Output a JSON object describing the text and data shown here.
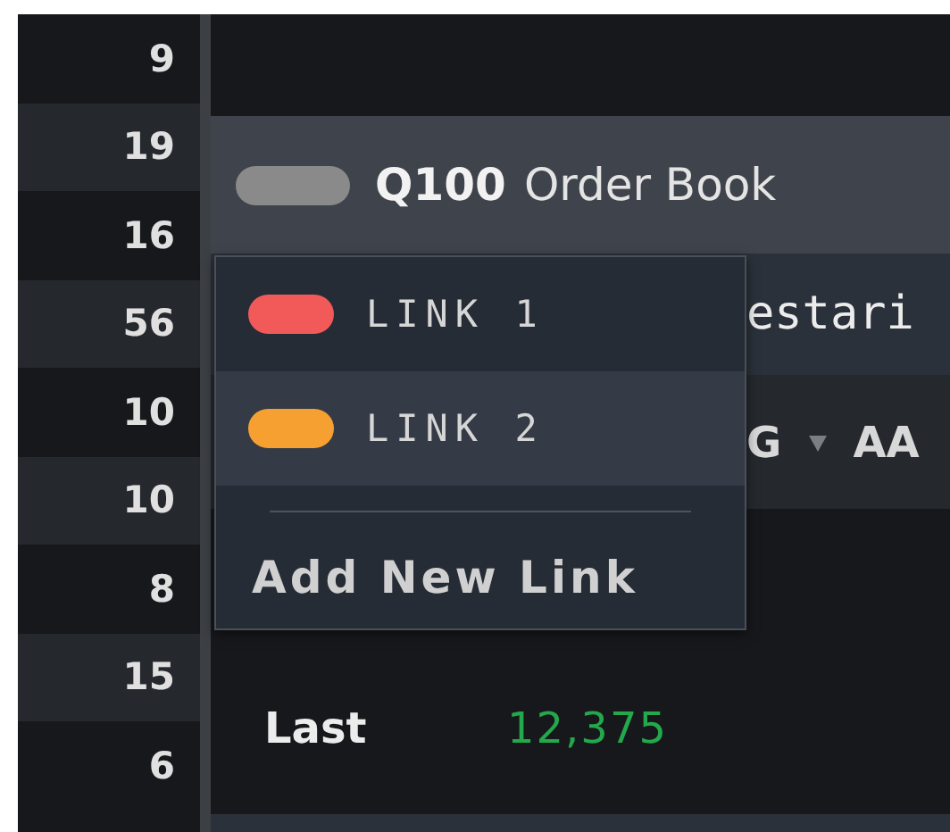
{
  "row_numbers": [
    "9",
    "19",
    "16",
    "56",
    "10",
    "10",
    "8",
    "15",
    "6"
  ],
  "panel": {
    "title_code": "Q100",
    "title": "Order Book",
    "tab_text": "estari",
    "column_headers": [
      "G",
      "AA"
    ],
    "rows": [
      {
        "label": "Last",
        "value": "12,375",
        "color": "#23a84c"
      }
    ]
  },
  "link_menu": {
    "items": [
      {
        "label": "LINK 1",
        "color": "#f25a5a",
        "selected": false
      },
      {
        "label": "LINK 2",
        "color": "#f7a032",
        "selected": true
      }
    ],
    "action": "Add New Link"
  }
}
